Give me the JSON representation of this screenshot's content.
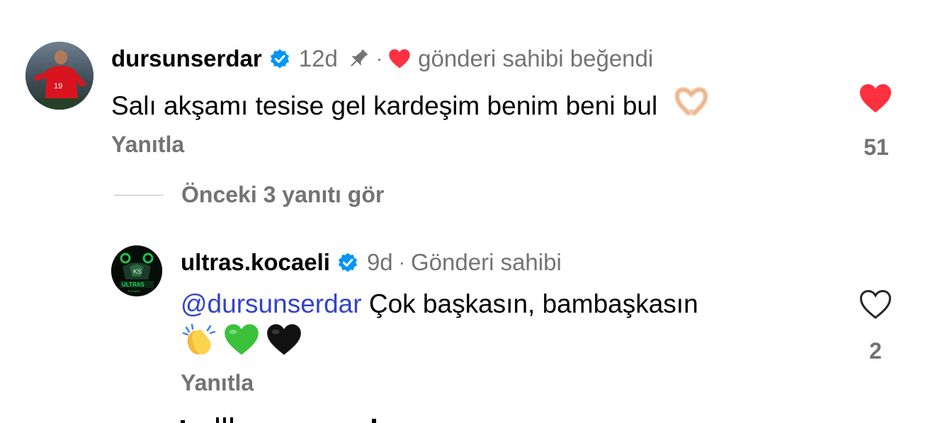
{
  "comments": [
    {
      "username": "dursunserdar",
      "verified": true,
      "time": "12d",
      "pinned": true,
      "author_liked_label": "gönderi sahibi beğendi",
      "text": "Salı akşamı tesise gel kardeşim benim beni bul",
      "emoji": "heart-hands",
      "reply_label": "Yanıtla",
      "liked": true,
      "like_count": "51"
    }
  ],
  "view_replies_label": "Önceki 3 yanıtı gör",
  "reply": {
    "username": "ultras.kocaeli",
    "verified": true,
    "time": "9d",
    "author_badge": "Gönderi sahibi",
    "mention": "@dursunserdar",
    "text": "Çok başkasın, bambaşkasın",
    "emojis": [
      "clapping-hands",
      "green-heart",
      "black-heart"
    ],
    "reply_label": "Yanıtla",
    "liked": false,
    "like_count": "2"
  },
  "colors": {
    "like_red": "#ff3040",
    "muted": "#737373",
    "mention": "#3243c8",
    "verified": "#0095f6"
  }
}
